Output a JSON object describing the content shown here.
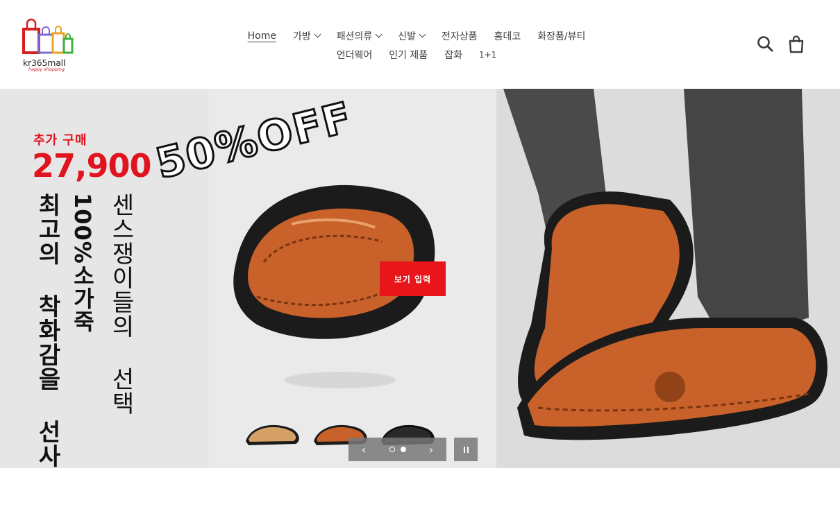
{
  "store": {
    "name": "kr365mall",
    "tagline": "happy shopping"
  },
  "nav": {
    "row1": [
      {
        "label": "Home",
        "active": true,
        "dropdown": false
      },
      {
        "label": "가방",
        "dropdown": true
      },
      {
        "label": "패션의류",
        "dropdown": true
      },
      {
        "label": "신발",
        "dropdown": true
      },
      {
        "label": "전자상품",
        "dropdown": false
      },
      {
        "label": "홈데코",
        "dropdown": false
      },
      {
        "label": "화장품/뷰티",
        "dropdown": false
      }
    ],
    "row2": [
      {
        "label": "언더웨어"
      },
      {
        "label": "인기 제품"
      },
      {
        "label": "잡화"
      },
      {
        "label": "1+1"
      }
    ]
  },
  "header_icons": [
    "search-icon",
    "cart-icon"
  ],
  "hero": {
    "promo_small": "추가 구매",
    "promo_price": "27,900",
    "vertical_1": "최고의 착화감을 선사",
    "vertical_2": "100%소가죽",
    "vertical_3": "센스쟁이들의 선택",
    "off_text": "50%OFF",
    "cta_label": "보기 입력",
    "slides_total": 2,
    "slide_current": 2,
    "prev_arrow": "‹",
    "next_arrow": "›",
    "colors": {
      "cta": "#e8151b",
      "promo": "#e0141e",
      "leather": "#c8612a"
    }
  }
}
